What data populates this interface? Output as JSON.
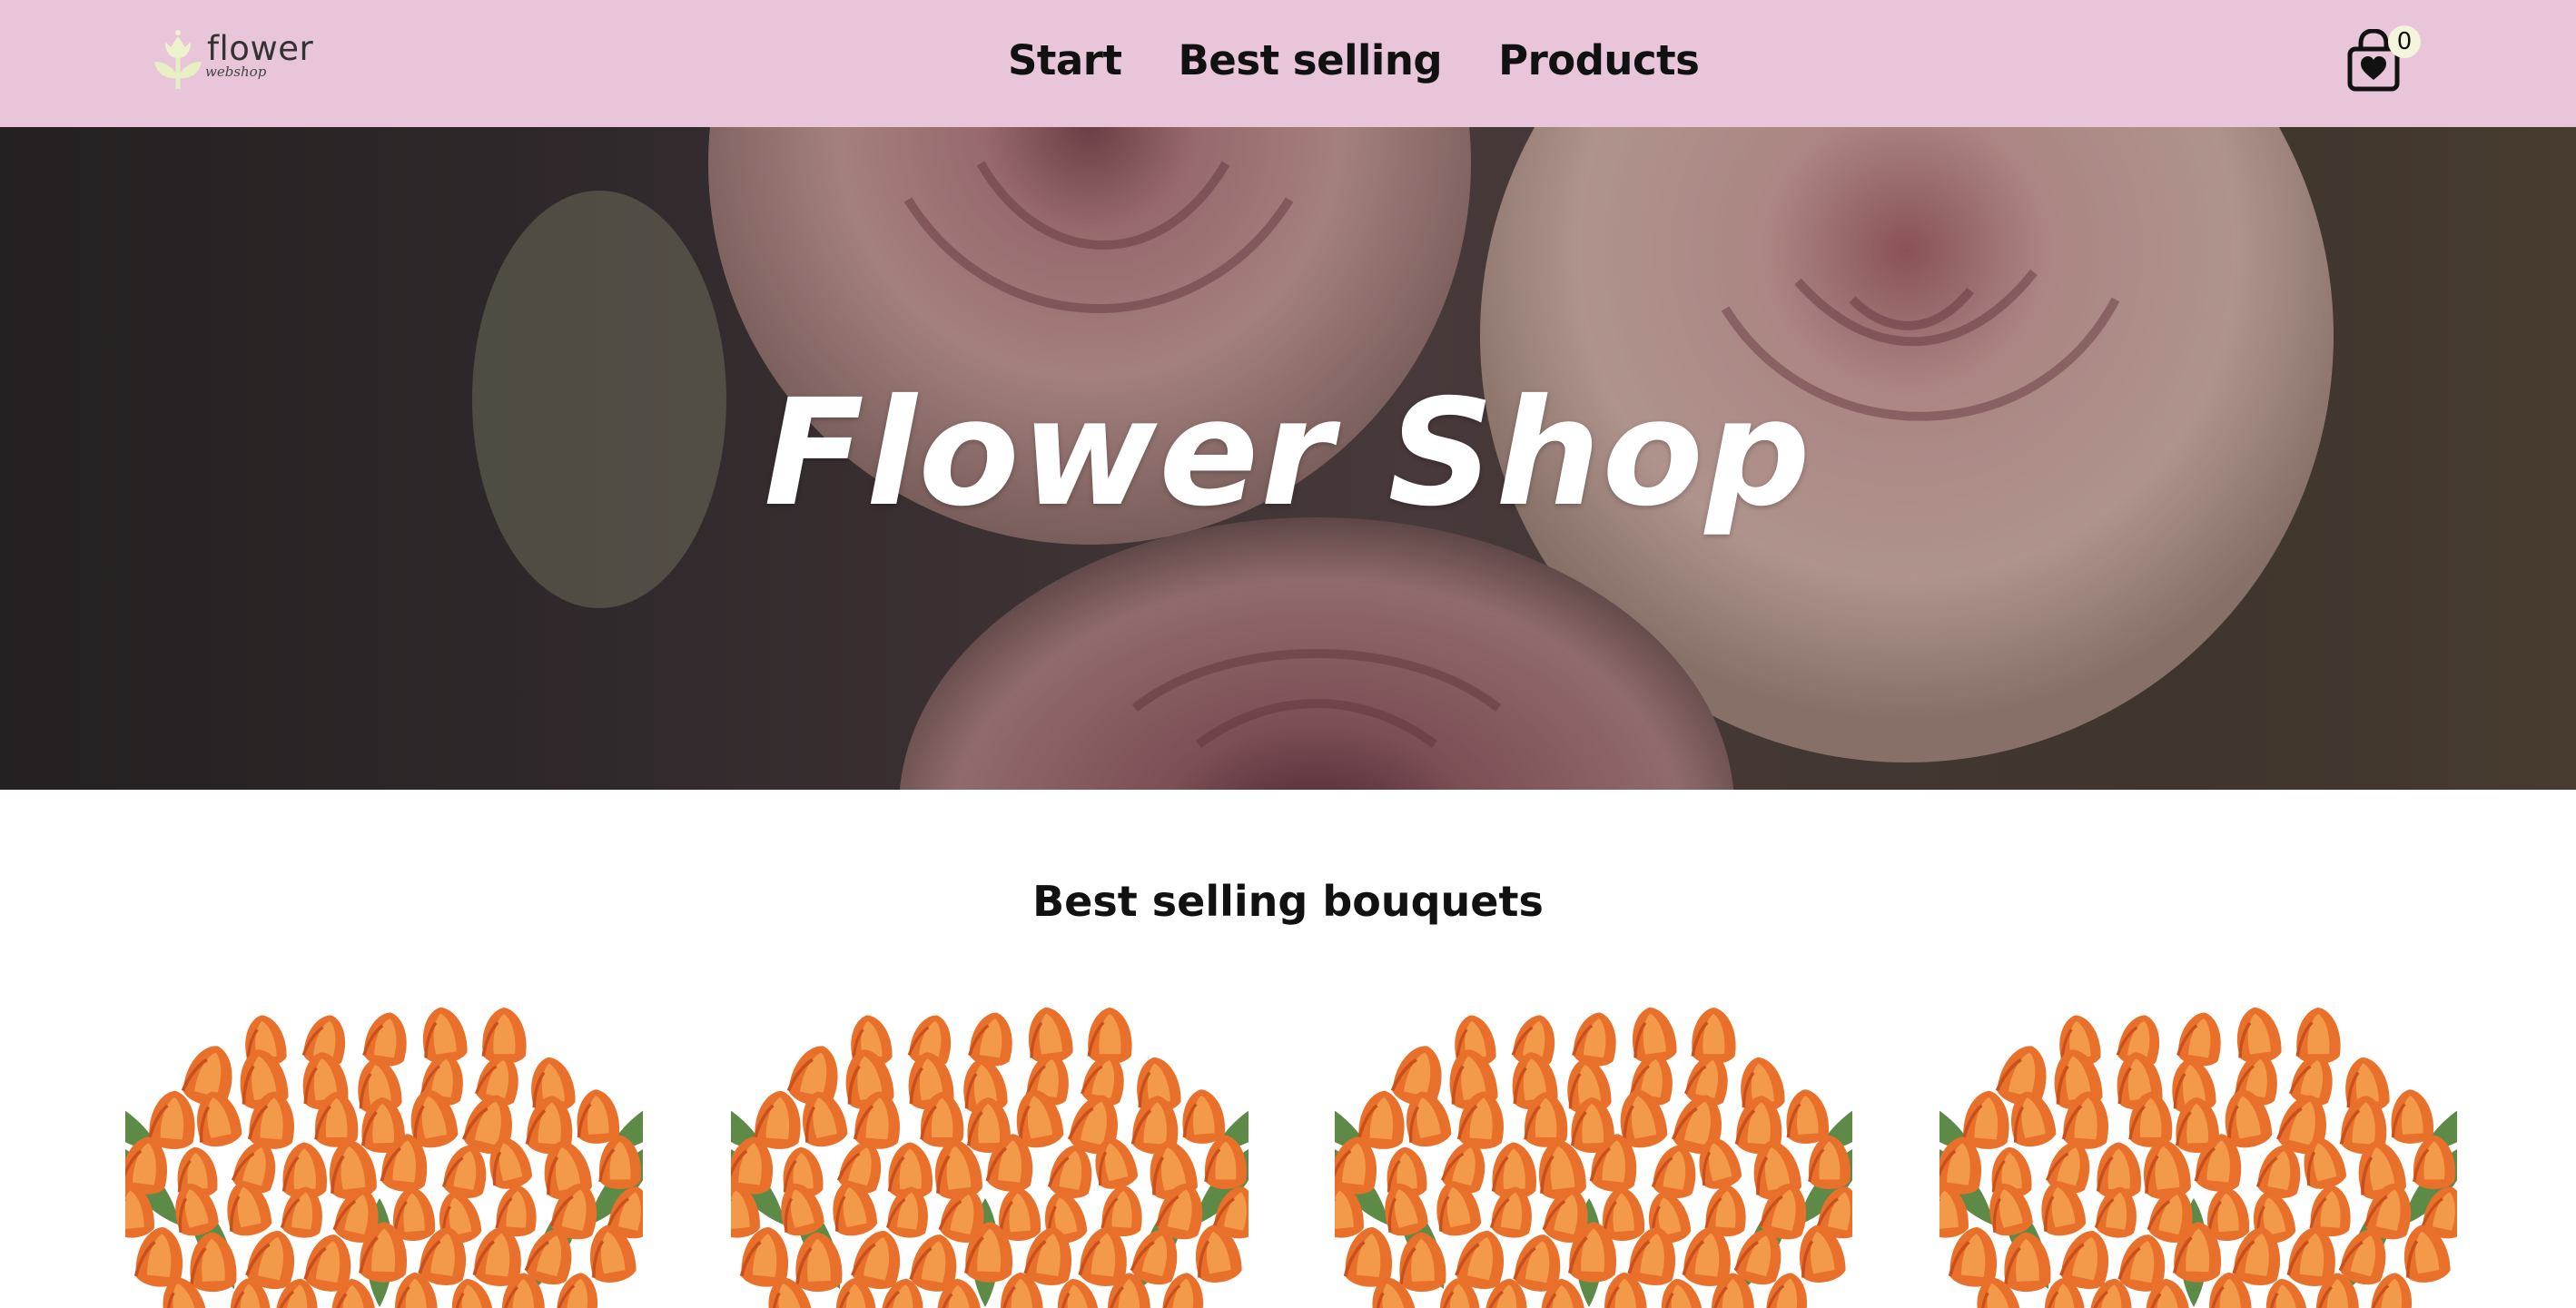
{
  "header": {
    "logo_text": "flower",
    "logo_subtext": "webshop",
    "nav": [
      {
        "label": "Start"
      },
      {
        "label": "Best selling"
      },
      {
        "label": "Products"
      }
    ],
    "cart_count": "0",
    "cart_icon": "shopping-bag-heart-icon"
  },
  "hero": {
    "title": "Flower Shop",
    "image": "pink-roses-photo"
  },
  "best_selling": {
    "heading": "Best selling bouquets",
    "products": [
      {
        "image": "orange-tulip-bouquet"
      },
      {
        "image": "orange-tulip-bouquet"
      },
      {
        "image": "orange-tulip-bouquet"
      },
      {
        "image": "orange-tulip-bouquet"
      }
    ]
  },
  "colors": {
    "navbar_bg": "#e8c5d8",
    "badge_bg": "#f5f4dc",
    "text": "#111111",
    "hero_text": "#ffffff",
    "tulip_orange": "#e8702a"
  }
}
